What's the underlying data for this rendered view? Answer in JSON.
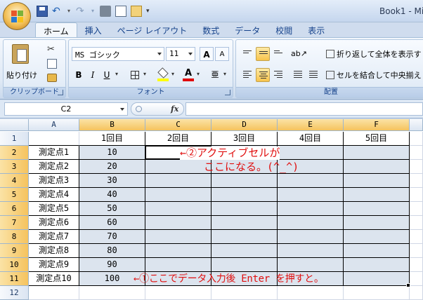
{
  "window": {
    "title": "Book1 - Mi"
  },
  "tabs": [
    "ホーム",
    "挿入",
    "ページ レイアウト",
    "数式",
    "データ",
    "校閲",
    "表示"
  ],
  "ribbon": {
    "clipboard": {
      "paste_label": "貼り付け",
      "group_label": "クリップボード"
    },
    "font": {
      "font_name": "MS ゴシック",
      "font_size": "11",
      "bold": "B",
      "italic": "I",
      "underline": "U",
      "grow": "A",
      "shrink": "A",
      "group_label": "フォント"
    },
    "alignment": {
      "wrap_text": "折り返して全体を表示す",
      "merge_center": "セルを結合して中央揃え",
      "group_label": "配置"
    }
  },
  "formula_bar": {
    "name_box": "C2",
    "fx": "fx",
    "value": ""
  },
  "columns": [
    "A",
    "B",
    "C",
    "D",
    "E",
    "F"
  ],
  "rows": [
    "1",
    "2",
    "3",
    "4",
    "5",
    "6",
    "7",
    "8",
    "9",
    "10",
    "11",
    "12"
  ],
  "table": {
    "headers": [
      "1回目",
      "2回目",
      "3回目",
      "4回目",
      "5回目"
    ],
    "labels": [
      "測定点1",
      "測定点2",
      "測定点3",
      "測定点4",
      "測定点5",
      "測定点6",
      "測定点7",
      "測定点8",
      "測定点9",
      "測定点10"
    ],
    "values": [
      "10",
      "20",
      "30",
      "40",
      "50",
      "60",
      "70",
      "80",
      "90",
      "100"
    ]
  },
  "annotations": {
    "active_note_line1": "←②アクティブセルが",
    "active_note_line2": "ここになる。(^_^)",
    "enter_note": "←①ここでデータ入力後 Enter を押すと。"
  },
  "colors": {
    "annotation": "#e01010",
    "selection_highlight": "#f5c35e"
  }
}
